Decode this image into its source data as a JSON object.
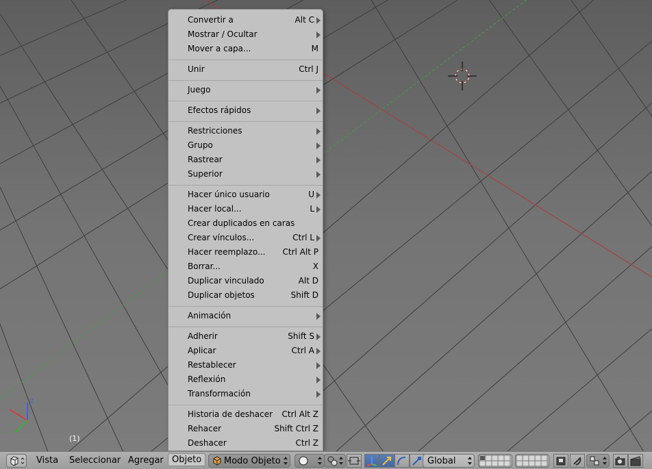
{
  "viewport": {
    "frame_label": "(1)",
    "axis_z_label": "z",
    "axis_x_color": "#d04040",
    "axis_y_color": "#38b038",
    "axis_z_color": "#4060e0"
  },
  "menu": {
    "items": [
      {
        "label": "Convertir a",
        "shortcut": "Alt C",
        "submenu": true
      },
      {
        "label": "Mostrar / Ocultar",
        "shortcut": "",
        "submenu": true
      },
      {
        "label": "Mover a capa...",
        "shortcut": "M",
        "submenu": false
      },
      {
        "label": "Unir",
        "shortcut": "Ctrl J",
        "submenu": false
      },
      {
        "label": "Juego",
        "shortcut": "",
        "submenu": true
      },
      {
        "label": "Efectos rápidos",
        "shortcut": "",
        "submenu": true
      },
      {
        "label": "Restricciones",
        "shortcut": "",
        "submenu": true
      },
      {
        "label": "Grupo",
        "shortcut": "",
        "submenu": true
      },
      {
        "label": "Rastrear",
        "shortcut": "",
        "submenu": true
      },
      {
        "label": "Superior",
        "shortcut": "",
        "submenu": true
      },
      {
        "label": "Hacer único usuario",
        "shortcut": "U",
        "submenu": true
      },
      {
        "label": "Hacer local...",
        "shortcut": "L",
        "submenu": true
      },
      {
        "label": "Crear duplicados en caras",
        "shortcut": "",
        "submenu": false
      },
      {
        "label": "Crear vínculos...",
        "shortcut": "Ctrl L",
        "submenu": true
      },
      {
        "label": "Hacer reemplazo...",
        "shortcut": "Ctrl Alt P",
        "submenu": false
      },
      {
        "label": "Borrar...",
        "shortcut": "X",
        "submenu": false
      },
      {
        "label": "Duplicar vinculado",
        "shortcut": "Alt D",
        "submenu": false
      },
      {
        "label": "Duplicar objetos",
        "shortcut": "Shift D",
        "submenu": false
      },
      {
        "label": "Animación",
        "shortcut": "",
        "submenu": true
      },
      {
        "label": "Adherir",
        "shortcut": "Shift S",
        "submenu": true
      },
      {
        "label": "Aplicar",
        "shortcut": "Ctrl A",
        "submenu": true
      },
      {
        "label": "Restablecer",
        "shortcut": "",
        "submenu": true
      },
      {
        "label": "Reflexión",
        "shortcut": "",
        "submenu": true
      },
      {
        "label": "Transformación",
        "shortcut": "",
        "submenu": true
      },
      {
        "label": "Historia de deshacer",
        "shortcut": "Ctrl Alt Z",
        "submenu": false
      },
      {
        "label": "Rehacer",
        "shortcut": "Shift Ctrl Z",
        "submenu": false
      },
      {
        "label": "Deshacer",
        "shortcut": "Ctrl Z",
        "submenu": false
      }
    ]
  },
  "header": {
    "menus": [
      "Vista",
      "Seleccionar",
      "Agregar",
      "Objeto"
    ],
    "active_menu": "Objeto",
    "mode": "Modo Objeto",
    "orientation": "Global"
  }
}
